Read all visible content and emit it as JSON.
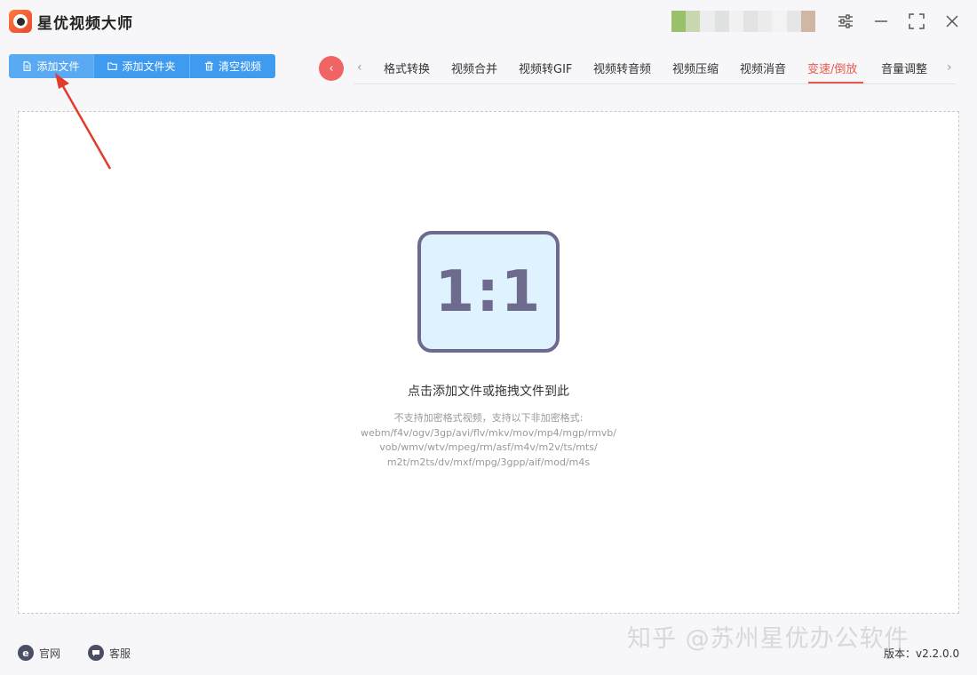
{
  "app": {
    "title": "星优视频大师"
  },
  "toolbar": {
    "add_file": "添加文件",
    "add_folder": "添加文件夹",
    "clear_videos": "清空视频"
  },
  "tabs": [
    {
      "label": "格式转换"
    },
    {
      "label": "视频合并"
    },
    {
      "label": "视频转GIF"
    },
    {
      "label": "视频转音频"
    },
    {
      "label": "视频压缩"
    },
    {
      "label": "视频消音"
    },
    {
      "label": "变速/倒放",
      "active": true
    },
    {
      "label": "音量调整"
    }
  ],
  "dropzone": {
    "icon_text": "1:1",
    "hint": "点击添加文件或拖拽文件到此",
    "formats_line1": "不支持加密格式视频，支持以下非加密格式:",
    "formats_line2": "webm/f4v/ogv/3gp/avi/flv/mkv/mov/mp4/mgp/rmvb/",
    "formats_line3": "vob/wmv/wtv/mpeg/rm/asf/m4v/m2v/ts/mts/",
    "formats_line4": "m2t/m2ts/dv/mxf/mpg/3gpp/aif/mod/m4s"
  },
  "footer": {
    "website": "官网",
    "support": "客服",
    "version": "版本：v2.2.0.0",
    "watermark": "知乎 @苏州星优办公软件"
  },
  "colors": {
    "accent_blue": "#3f9bf0",
    "active_tab": "#e55a4f",
    "back_button": "#f06464"
  }
}
